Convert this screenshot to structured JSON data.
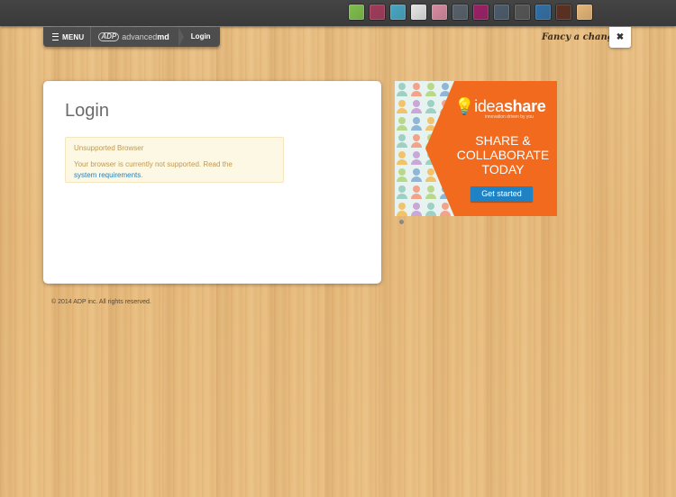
{
  "theme_swatches": [
    {
      "name": "green-theme",
      "color": "#7fbf4a"
    },
    {
      "name": "berry-theme",
      "color": "#a33a5a"
    },
    {
      "name": "teal-theme",
      "color": "#47a7c4"
    },
    {
      "name": "white-theme",
      "color": "#e6e6e6"
    },
    {
      "name": "pink-theme",
      "color": "#d98aa0"
    },
    {
      "name": "slate-theme",
      "color": "#56606a"
    },
    {
      "name": "magenta-theme",
      "color": "#9b1f66"
    },
    {
      "name": "steel-theme",
      "color": "#4b5b6a"
    },
    {
      "name": "charcoal-theme",
      "color": "#545454"
    },
    {
      "name": "blue-theme",
      "color": "#2f6fa6"
    },
    {
      "name": "walnut-theme",
      "color": "#5b2f1f"
    },
    {
      "name": "wood-theme",
      "color": "#e7b777"
    }
  ],
  "nav": {
    "menu_label": "MENU",
    "brand_prefix": "advanced",
    "brand_bold": "md",
    "adp_mark": "ADP",
    "breadcrumb": "Login"
  },
  "fancy_text": "Fancy a change?",
  "close_glyph": "✖",
  "login": {
    "title": "Login",
    "alert_title": "Unsupported Browser",
    "alert_text": "Your browser is currently not supported. Read the",
    "alert_link": "system requirements",
    "alert_tail": "."
  },
  "ad": {
    "logo_light": "idea",
    "logo_bold": "share",
    "tagline": "innovation driven by you",
    "headline_1": "SHARE &",
    "headline_2": "COLLABORATE",
    "headline_3": "TODAY",
    "cta": "Get started"
  },
  "footer": "© 2014 ADP inc. All rights reserved."
}
